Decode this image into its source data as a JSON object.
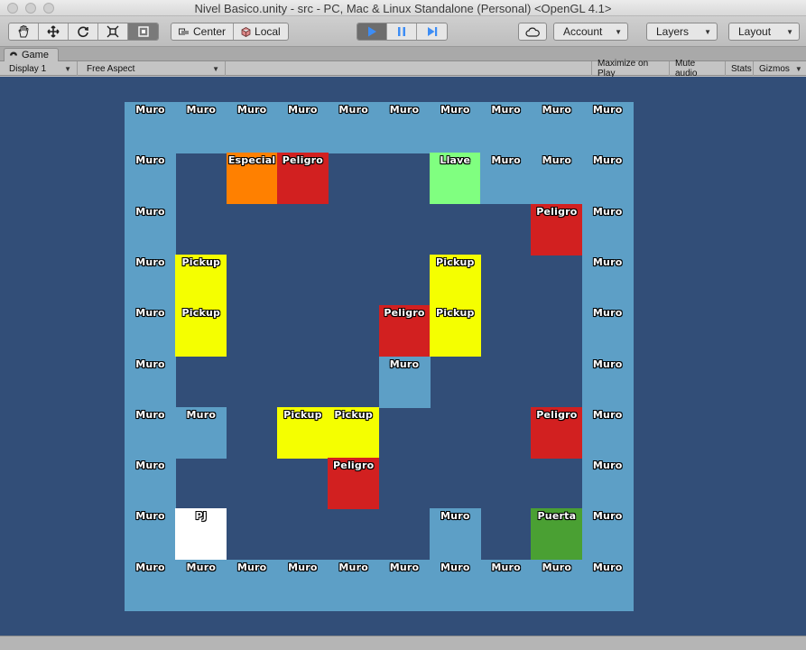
{
  "window": {
    "title": "Nivel Basico.unity - src - PC, Mac & Linux Standalone (Personal) <OpenGL 4.1>"
  },
  "toolbar": {
    "tools": [
      "hand-icon",
      "move-icon",
      "rotate-icon",
      "scale-icon",
      "rect-tool-icon"
    ],
    "active_tool": "rect-tool-icon",
    "pivot_label": "Center",
    "space_label": "Local",
    "play": {
      "playing": true,
      "paused": false
    },
    "cloud_icon": "cloud-icon",
    "account_label": "Account",
    "layers_label": "Layers",
    "layout_label": "Layout"
  },
  "game_tab": {
    "label": "Game",
    "icon": "game-controller-icon"
  },
  "game_toolbar": {
    "display": "Display 1",
    "aspect": "Free Aspect",
    "maximize_on_play": "Maximize on Play",
    "mute_audio": "Mute audio",
    "stats": "Stats",
    "gizmos": "Gizmos"
  },
  "colors": {
    "background": "#324e78",
    "Muro": "#5d9fc6",
    "Especial": "#ff8000",
    "Peligro": "#d22020",
    "Llave": "#80ff80",
    "Pickup": "#f5ff00",
    "PJ": "#ffffff",
    "Puerta": "#4aa033"
  },
  "board": {
    "columns": 10,
    "rows": 10,
    "cells": [
      {
        "row": 0,
        "col": 0,
        "type": "Muro"
      },
      {
        "row": 0,
        "col": 1,
        "type": "Muro"
      },
      {
        "row": 0,
        "col": 2,
        "type": "Muro"
      },
      {
        "row": 0,
        "col": 3,
        "type": "Muro"
      },
      {
        "row": 0,
        "col": 4,
        "type": "Muro"
      },
      {
        "row": 0,
        "col": 5,
        "type": "Muro"
      },
      {
        "row": 0,
        "col": 6,
        "type": "Muro"
      },
      {
        "row": 0,
        "col": 7,
        "type": "Muro"
      },
      {
        "row": 0,
        "col": 8,
        "type": "Muro"
      },
      {
        "row": 0,
        "col": 9,
        "type": "Muro"
      },
      {
        "row": 1,
        "col": 0,
        "type": "Muro"
      },
      {
        "row": 1,
        "col": 2,
        "type": "Especial"
      },
      {
        "row": 1,
        "col": 3,
        "type": "Peligro"
      },
      {
        "row": 1,
        "col": 6,
        "type": "Llave"
      },
      {
        "row": 1,
        "col": 7,
        "type": "Muro"
      },
      {
        "row": 1,
        "col": 8,
        "type": "Muro"
      },
      {
        "row": 1,
        "col": 9,
        "type": "Muro"
      },
      {
        "row": 2,
        "col": 0,
        "type": "Muro"
      },
      {
        "row": 2,
        "col": 8,
        "type": "Peligro"
      },
      {
        "row": 2,
        "col": 9,
        "type": "Muro"
      },
      {
        "row": 3,
        "col": 0,
        "type": "Muro"
      },
      {
        "row": 3,
        "col": 1,
        "type": "Pickup"
      },
      {
        "row": 3,
        "col": 6,
        "type": "Pickup"
      },
      {
        "row": 3,
        "col": 9,
        "type": "Muro"
      },
      {
        "row": 4,
        "col": 0,
        "type": "Muro"
      },
      {
        "row": 4,
        "col": 1,
        "type": "Pickup"
      },
      {
        "row": 4,
        "col": 5,
        "type": "Peligro"
      },
      {
        "row": 4,
        "col": 6,
        "type": "Pickup"
      },
      {
        "row": 4,
        "col": 9,
        "type": "Muro"
      },
      {
        "row": 5,
        "col": 0,
        "type": "Muro"
      },
      {
        "row": 5,
        "col": 5,
        "type": "Muro"
      },
      {
        "row": 5,
        "col": 9,
        "type": "Muro"
      },
      {
        "row": 6,
        "col": 0,
        "type": "Muro"
      },
      {
        "row": 6,
        "col": 1,
        "type": "Muro"
      },
      {
        "row": 6,
        "col": 3,
        "type": "Pickup"
      },
      {
        "row": 6,
        "col": 4,
        "type": "Pickup"
      },
      {
        "row": 6,
        "col": 8,
        "type": "Peligro"
      },
      {
        "row": 6,
        "col": 9,
        "type": "Muro"
      },
      {
        "row": 7,
        "col": 0,
        "type": "Muro"
      },
      {
        "row": 7,
        "col": 4,
        "type": "Peligro"
      },
      {
        "row": 7,
        "col": 9,
        "type": "Muro"
      },
      {
        "row": 8,
        "col": 0,
        "type": "Muro"
      },
      {
        "row": 8,
        "col": 1,
        "type": "PJ"
      },
      {
        "row": 8,
        "col": 6,
        "type": "Muro"
      },
      {
        "row": 8,
        "col": 8,
        "type": "Puerta"
      },
      {
        "row": 8,
        "col": 9,
        "type": "Muro"
      },
      {
        "row": 9,
        "col": 0,
        "type": "Muro"
      },
      {
        "row": 9,
        "col": 1,
        "type": "Muro"
      },
      {
        "row": 9,
        "col": 2,
        "type": "Muro"
      },
      {
        "row": 9,
        "col": 3,
        "type": "Muro"
      },
      {
        "row": 9,
        "col": 4,
        "type": "Muro"
      },
      {
        "row": 9,
        "col": 5,
        "type": "Muro"
      },
      {
        "row": 9,
        "col": 6,
        "type": "Muro"
      },
      {
        "row": 9,
        "col": 7,
        "type": "Muro"
      },
      {
        "row": 9,
        "col": 8,
        "type": "Muro"
      },
      {
        "row": 9,
        "col": 9,
        "type": "Muro"
      }
    ]
  }
}
